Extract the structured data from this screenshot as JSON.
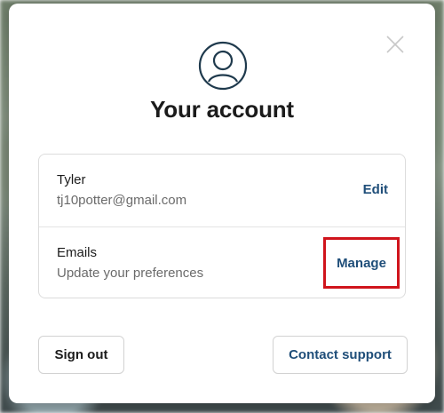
{
  "dialog": {
    "title": "Your account",
    "icons": {
      "close": "close-icon",
      "avatar": "user-circle-icon"
    },
    "account": {
      "name": "Tyler",
      "email": "tj10potter@gmail.com",
      "edit_label": "Edit"
    },
    "emails": {
      "label": "Emails",
      "description": "Update your preferences",
      "manage_label": "Manage"
    },
    "buttons": {
      "sign_out": "Sign out",
      "contact_support": "Contact support"
    }
  },
  "colors": {
    "accent": "#1f4e79",
    "highlight": "#d0141c",
    "title": "#1b1b1b",
    "secondary_text": "#6b6b6b"
  }
}
